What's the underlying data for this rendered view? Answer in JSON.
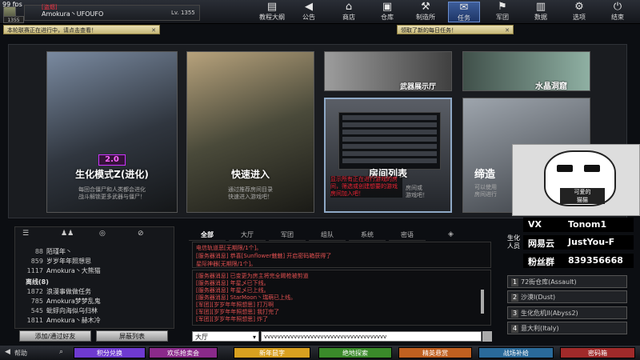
{
  "fps": "99 fps",
  "player": {
    "guild": "[盗烟]",
    "name": "Amokura丶UFOUFO",
    "level": "Lv. 1355",
    "avatar_level": "1355"
  },
  "nav": [
    {
      "icon": "book-icon",
      "glyph": "▤",
      "label": "教程大纲"
    },
    {
      "icon": "megaphone-icon",
      "glyph": "◀",
      "label": "公告"
    },
    {
      "icon": "shop-icon",
      "glyph": "⌂",
      "label": "商店"
    },
    {
      "icon": "warehouse-icon",
      "glyph": "▣",
      "label": "仓库"
    },
    {
      "icon": "factory-icon",
      "glyph": "⚒",
      "label": "制造所"
    },
    {
      "icon": "mission-icon",
      "glyph": "✉",
      "label": "任务"
    },
    {
      "icon": "corps-icon",
      "glyph": "⚑",
      "label": "军团"
    },
    {
      "icon": "data-icon",
      "glyph": "▥",
      "label": "数据"
    },
    {
      "icon": "settings-icon",
      "glyph": "⚙",
      "label": "选项"
    },
    {
      "icon": "power-icon",
      "glyph": "⏻",
      "label": "结束"
    }
  ],
  "banners": {
    "left": "本轮联赛正在进行中，请点击查看！",
    "right": "领取了新的每日任务！"
  },
  "modes": {
    "bio": {
      "badge": "2.0",
      "title": "生化模式Z(进化)",
      "sub1": "每回合僵尸和人类都会进化",
      "sub2": "战斗解锁更多武器与僵尸！"
    },
    "quick": {
      "title": "快速进入",
      "sub1": "通过推荐房间目录",
      "sub2": "快速进入游戏吧！"
    },
    "weapon": {
      "title": "武器展示厅"
    },
    "crystal": {
      "title": "水晶洞窟"
    },
    "rooms": {
      "title": "房间列表",
      "hint": "显示所有正在进行游戏的房间，筛选或创建想要的游戏房间加入吧！",
      "sub1": "房间或",
      "sub2": "游戏吧！"
    },
    "shrink": {
      "title": "缔造",
      "sub1": "可以使用",
      "sub2": "房间进行"
    }
  },
  "overlay": {
    "text1": "可爱的",
    "text2": "猫猫"
  },
  "social": [
    {
      "key": "VX",
      "value": "Tonom1"
    },
    {
      "key": "网易云",
      "value": "JustYou-F"
    },
    {
      "key": "粉丝群",
      "value": "839356668"
    }
  ],
  "friends": {
    "list": [
      {
        "num": "88",
        "name": "陌瑾年丶"
      },
      {
        "num": "859",
        "name": "岁岁年年照想思"
      },
      {
        "num": "1117",
        "name": "Amokura丶大熊猫"
      }
    ],
    "group": "离线(8)",
    "offline": [
      {
        "num": "1872",
        "name": "浪漫事做做任务"
      },
      {
        "num": "785",
        "name": "Amokura梦梦乱鬼"
      },
      {
        "num": "545",
        "name": "蚍蜉向海似乌归林"
      },
      {
        "num": "1811",
        "name": "Amokura丶赫木冷"
      }
    ],
    "add_btn": "添加/通过好友",
    "block_btn": "屏蔽列表"
  },
  "chat": {
    "tabs": [
      "全部",
      "大厅",
      "军团",
      "组队",
      "系统",
      "密语"
    ],
    "pane1": [
      {
        "text": "电信轨道恶[无期限/1个]。",
        "color": "#e05050"
      },
      {
        "text": "[服务器消息] 恭喜[Sunflower魅魅] 开启密码箱获得了",
        "color": "#e05050"
      },
      {
        "text": "星际神器[无期限/1个]。",
        "color": "#e05050"
      }
    ],
    "pane2": [
      {
        "text": "[服务器消息] 已变更为房主将完全踢枪被剪道",
        "color": "#e05050"
      },
      {
        "text": "[服务器消息] 年星乄已下线。",
        "color": "#e05050"
      },
      {
        "text": "[服务器消息] 年星乄已上线。",
        "color": "#e05050"
      },
      {
        "text": "[服务器消息] StarMoon丶瑞萌已上线。",
        "color": "#e05050"
      },
      {
        "text": "[军团][岁岁年年照想思] 打万啊",
        "color": "#e05050"
      },
      {
        "text": "[军团][岁岁年年照想思] 我打完了",
        "color": "#e05050"
      },
      {
        "text": "[军团][岁岁年年照想思] 炸了",
        "color": "#e05050"
      }
    ],
    "channel": "大厅",
    "input_value": "vvvvvvvvvvvvvvvvvvvvvvvvvvvvvvvvvvvvv"
  },
  "servers": {
    "head": "生化 人员",
    "list": [
      {
        "num": "1",
        "name": "72街仓库(Assault)"
      },
      {
        "num": "2",
        "name": "沙漠I(Dust)"
      },
      {
        "num": "3",
        "name": "生化危机II(Abyss2)"
      },
      {
        "num": "4",
        "name": "意大利(Italy)"
      }
    ]
  },
  "bottom": {
    "help": "帮助",
    "buttons": [
      {
        "label": "积分兑换",
        "color": "#6e3ad0"
      },
      {
        "label": "欢乐抢卖会",
        "color": "#8a2a8a"
      },
      {
        "label": "新年鼠字",
        "color": "#d8a020"
      },
      {
        "label": "绝地探索",
        "color": "#3a8a2a"
      },
      {
        "label": "精英悬赏",
        "color": "#c06020"
      },
      {
        "label": "战场补给",
        "color": "#2a6a9a"
      },
      {
        "label": "密码箱",
        "color": "#a02a2a"
      }
    ]
  },
  "colors": {
    "accent": "#3d5d9a",
    "banner": "#e9dfb2",
    "alert": "#e05050"
  }
}
